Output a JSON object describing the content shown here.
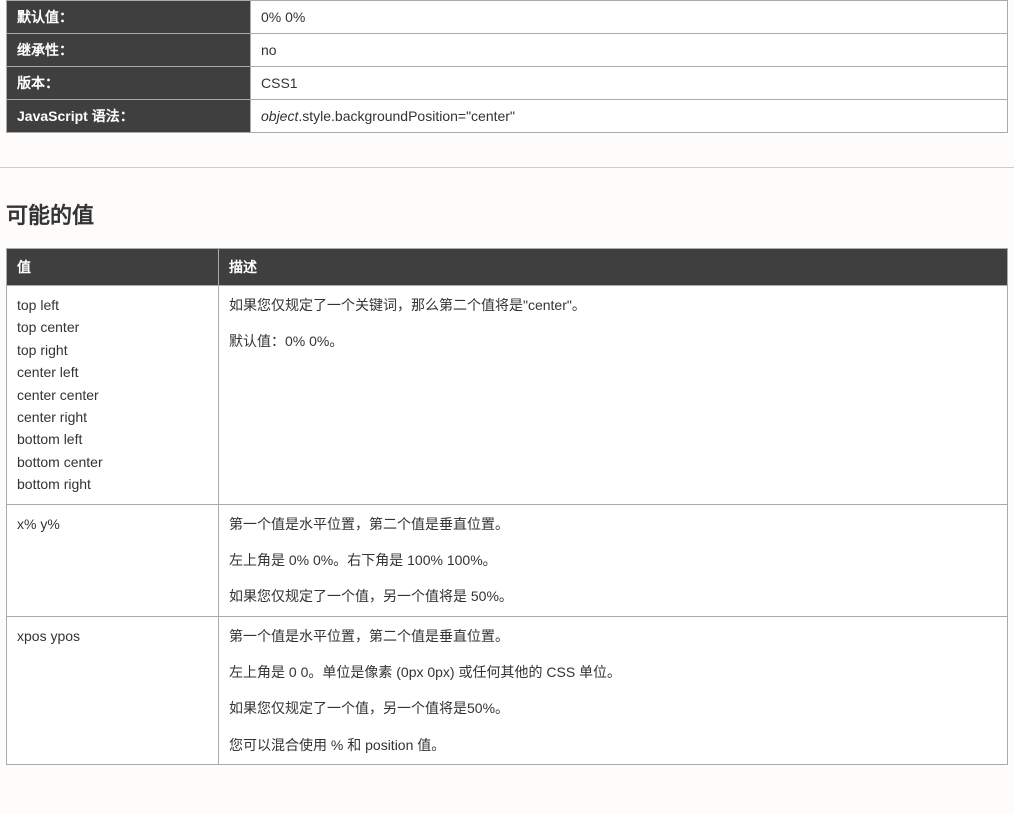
{
  "properties": {
    "rows": [
      {
        "label": "默认值：",
        "value": "0% 0%"
      },
      {
        "label": "继承性：",
        "value": "no"
      },
      {
        "label": "版本：",
        "value": "CSS1"
      },
      {
        "label": "JavaScript 语法：",
        "value_italic": "object",
        "value_rest": ".style.backgroundPosition=\"center\""
      }
    ]
  },
  "section_title": "可能的值",
  "values_table": {
    "headers": [
      "值",
      "描述"
    ],
    "rows": [
      {
        "value_lines": [
          "top left",
          "top center",
          "top right",
          "center left",
          "center center",
          "center right",
          "bottom left",
          "bottom center",
          "bottom right"
        ],
        "desc_paragraphs": [
          "如果您仅规定了一个关键词，那么第二个值将是\"center\"。",
          "默认值：0% 0%。"
        ]
      },
      {
        "value_lines": [
          "x% y%"
        ],
        "desc_paragraphs": [
          "第一个值是水平位置，第二个值是垂直位置。",
          "左上角是 0% 0%。右下角是 100% 100%。",
          "如果您仅规定了一个值，另一个值将是 50%。"
        ]
      },
      {
        "value_lines": [
          "xpos ypos"
        ],
        "desc_paragraphs": [
          "第一个值是水平位置，第二个值是垂直位置。",
          "左上角是 0 0。单位是像素 (0px 0px) 或任何其他的 CSS 单位。",
          "如果您仅规定了一个值，另一个值将是50%。",
          "您可以混合使用 % 和 position 值。"
        ]
      }
    ]
  }
}
